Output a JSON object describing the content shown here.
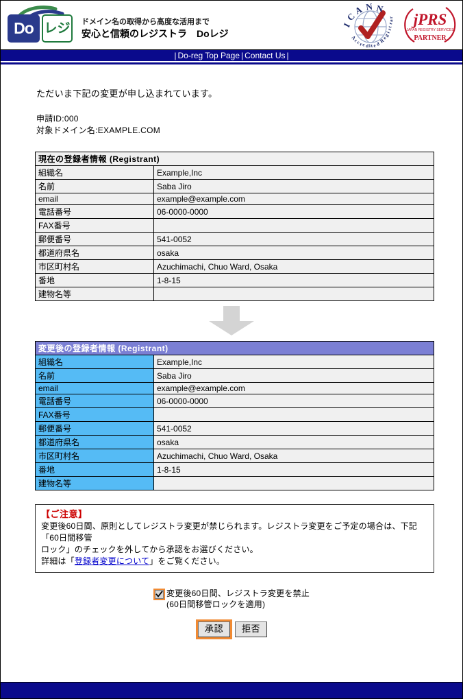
{
  "header": {
    "logo": {
      "do_text": "Do",
      "reji_text": "レジ",
      "alt": "Do-reg logo"
    },
    "tagline_line1": "ドメイン名の取得から高度な活用まで",
    "tagline_line2": "安心と信頼のレジストラ　Doレジ",
    "icann_badge": {
      "name": "ICANN",
      "sub": "Accredited Registrar"
    },
    "jprs_badge": {
      "name": "jPRS",
      "sub": "JAPAN REGISTRY SERVICES",
      "partner": "PARTNER"
    }
  },
  "nav": {
    "items": [
      {
        "label": "Do-reg Top Page"
      },
      {
        "label": "Contact Us"
      }
    ],
    "separator": "|"
  },
  "main": {
    "intro": "ただいま下記の変更が申し込まれています。",
    "application_id_label": "申請ID:",
    "application_id_value": "000",
    "domain_label": "対象ドメイン名:",
    "domain_value": "EXAMPLE.COM"
  },
  "current_table": {
    "caption": "現在の登録者情報 (Registrant)",
    "rows": [
      {
        "label": "組織名",
        "value": "Example,Inc"
      },
      {
        "label": "名前",
        "value": "Saba Jiro"
      },
      {
        "label": "email",
        "value": "example@example.com"
      },
      {
        "label": "電話番号",
        "value": "06-0000-0000"
      },
      {
        "label": "FAX番号",
        "value": ""
      },
      {
        "label": "郵便番号",
        "value": "541-0052"
      },
      {
        "label": "都道府県名",
        "value": "osaka"
      },
      {
        "label": "市区町村名",
        "value": "Azuchimachi, Chuo Ward, Osaka"
      },
      {
        "label": "番地",
        "value": "1-8-15"
      },
      {
        "label": "建物名等",
        "value": ""
      }
    ]
  },
  "arrow": {
    "name": "down-arrow",
    "color": "#d4d4d4"
  },
  "new_table": {
    "caption": "変更後の登録者情報 (Registrant)",
    "header_color": "#7b7fd4",
    "label_color": "#55bbf5",
    "rows": [
      {
        "label": "組織名",
        "value": "Example,Inc"
      },
      {
        "label": "名前",
        "value": "Saba Jiro"
      },
      {
        "label": "email",
        "value": "example@example.com"
      },
      {
        "label": "電話番号",
        "value": "06-0000-0000"
      },
      {
        "label": "FAX番号",
        "value": ""
      },
      {
        "label": "郵便番号",
        "value": "541-0052"
      },
      {
        "label": "都道府県名",
        "value": "osaka"
      },
      {
        "label": "市区町村名",
        "value": "Azuchimachi, Chuo Ward, Osaka"
      },
      {
        "label": "番地",
        "value": "1-8-15"
      },
      {
        "label": "建物名等",
        "value": ""
      }
    ]
  },
  "notice": {
    "title": "【ご注意】",
    "line1": "変更後60日間、原則としてレジストラ変更が禁じられます。レジストラ変更をご予定の場合は、下記「60日間移管",
    "line2": "ロック」のチェックを外してから承認をお選びください。",
    "line3_prefix": "詳細は「",
    "line3_link": "登録者変更について",
    "line3_suffix": "」をご覧ください。",
    "title_color": "#cc0000",
    "link_color": "#0000cc"
  },
  "checkbox": {
    "checked": true,
    "focus_color": "#f08a33",
    "label_line1": "変更後60日間、レジストラ変更を禁止",
    "label_line2": "(60日間移管ロックを適用)"
  },
  "buttons": {
    "approve_label": "承認",
    "reject_label": "拒否",
    "focus_color": "#f08a33"
  },
  "footer": {
    "color": "#0a0a8c"
  }
}
